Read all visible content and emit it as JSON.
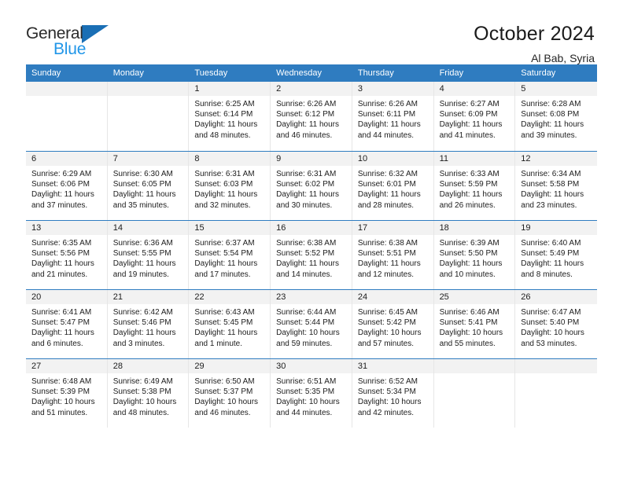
{
  "logo": {
    "line1": "General",
    "line2": "Blue",
    "triangle_icon": "logo-triangle-icon",
    "accent_dark": "#1a6fb5",
    "accent_light": "#2196e8"
  },
  "header": {
    "title": "October 2024",
    "subtitle": "Al Bab, Syria"
  },
  "theme": {
    "header_blue": "#2f7cc0",
    "daynum_band": "#f2f2f2",
    "cell_border": "#e6e6e6"
  },
  "weekdays": [
    "Sunday",
    "Monday",
    "Tuesday",
    "Wednesday",
    "Thursday",
    "Friday",
    "Saturday"
  ],
  "labels": {
    "sunrise": "Sunrise:",
    "sunset": "Sunset:",
    "daylight": "Daylight:"
  },
  "weeks": [
    [
      {
        "day": "",
        "sunrise": "",
        "sunset": "",
        "daylight": "",
        "empty": true
      },
      {
        "day": "",
        "sunrise": "",
        "sunset": "",
        "daylight": "",
        "empty": true
      },
      {
        "day": "1",
        "sunrise": "Sunrise: 6:25 AM",
        "sunset": "Sunset: 6:14 PM",
        "daylight": "Daylight: 11 hours and 48 minutes."
      },
      {
        "day": "2",
        "sunrise": "Sunrise: 6:26 AM",
        "sunset": "Sunset: 6:12 PM",
        "daylight": "Daylight: 11 hours and 46 minutes."
      },
      {
        "day": "3",
        "sunrise": "Sunrise: 6:26 AM",
        "sunset": "Sunset: 6:11 PM",
        "daylight": "Daylight: 11 hours and 44 minutes."
      },
      {
        "day": "4",
        "sunrise": "Sunrise: 6:27 AM",
        "sunset": "Sunset: 6:09 PM",
        "daylight": "Daylight: 11 hours and 41 minutes."
      },
      {
        "day": "5",
        "sunrise": "Sunrise: 6:28 AM",
        "sunset": "Sunset: 6:08 PM",
        "daylight": "Daylight: 11 hours and 39 minutes."
      }
    ],
    [
      {
        "day": "6",
        "sunrise": "Sunrise: 6:29 AM",
        "sunset": "Sunset: 6:06 PM",
        "daylight": "Daylight: 11 hours and 37 minutes."
      },
      {
        "day": "7",
        "sunrise": "Sunrise: 6:30 AM",
        "sunset": "Sunset: 6:05 PM",
        "daylight": "Daylight: 11 hours and 35 minutes."
      },
      {
        "day": "8",
        "sunrise": "Sunrise: 6:31 AM",
        "sunset": "Sunset: 6:03 PM",
        "daylight": "Daylight: 11 hours and 32 minutes."
      },
      {
        "day": "9",
        "sunrise": "Sunrise: 6:31 AM",
        "sunset": "Sunset: 6:02 PM",
        "daylight": "Daylight: 11 hours and 30 minutes."
      },
      {
        "day": "10",
        "sunrise": "Sunrise: 6:32 AM",
        "sunset": "Sunset: 6:01 PM",
        "daylight": "Daylight: 11 hours and 28 minutes."
      },
      {
        "day": "11",
        "sunrise": "Sunrise: 6:33 AM",
        "sunset": "Sunset: 5:59 PM",
        "daylight": "Daylight: 11 hours and 26 minutes."
      },
      {
        "day": "12",
        "sunrise": "Sunrise: 6:34 AM",
        "sunset": "Sunset: 5:58 PM",
        "daylight": "Daylight: 11 hours and 23 minutes."
      }
    ],
    [
      {
        "day": "13",
        "sunrise": "Sunrise: 6:35 AM",
        "sunset": "Sunset: 5:56 PM",
        "daylight": "Daylight: 11 hours and 21 minutes."
      },
      {
        "day": "14",
        "sunrise": "Sunrise: 6:36 AM",
        "sunset": "Sunset: 5:55 PM",
        "daylight": "Daylight: 11 hours and 19 minutes."
      },
      {
        "day": "15",
        "sunrise": "Sunrise: 6:37 AM",
        "sunset": "Sunset: 5:54 PM",
        "daylight": "Daylight: 11 hours and 17 minutes."
      },
      {
        "day": "16",
        "sunrise": "Sunrise: 6:38 AM",
        "sunset": "Sunset: 5:52 PM",
        "daylight": "Daylight: 11 hours and 14 minutes."
      },
      {
        "day": "17",
        "sunrise": "Sunrise: 6:38 AM",
        "sunset": "Sunset: 5:51 PM",
        "daylight": "Daylight: 11 hours and 12 minutes."
      },
      {
        "day": "18",
        "sunrise": "Sunrise: 6:39 AM",
        "sunset": "Sunset: 5:50 PM",
        "daylight": "Daylight: 11 hours and 10 minutes."
      },
      {
        "day": "19",
        "sunrise": "Sunrise: 6:40 AM",
        "sunset": "Sunset: 5:49 PM",
        "daylight": "Daylight: 11 hours and 8 minutes."
      }
    ],
    [
      {
        "day": "20",
        "sunrise": "Sunrise: 6:41 AM",
        "sunset": "Sunset: 5:47 PM",
        "daylight": "Daylight: 11 hours and 6 minutes."
      },
      {
        "day": "21",
        "sunrise": "Sunrise: 6:42 AM",
        "sunset": "Sunset: 5:46 PM",
        "daylight": "Daylight: 11 hours and 3 minutes."
      },
      {
        "day": "22",
        "sunrise": "Sunrise: 6:43 AM",
        "sunset": "Sunset: 5:45 PM",
        "daylight": "Daylight: 11 hours and 1 minute."
      },
      {
        "day": "23",
        "sunrise": "Sunrise: 6:44 AM",
        "sunset": "Sunset: 5:44 PM",
        "daylight": "Daylight: 10 hours and 59 minutes."
      },
      {
        "day": "24",
        "sunrise": "Sunrise: 6:45 AM",
        "sunset": "Sunset: 5:42 PM",
        "daylight": "Daylight: 10 hours and 57 minutes."
      },
      {
        "day": "25",
        "sunrise": "Sunrise: 6:46 AM",
        "sunset": "Sunset: 5:41 PM",
        "daylight": "Daylight: 10 hours and 55 minutes."
      },
      {
        "day": "26",
        "sunrise": "Sunrise: 6:47 AM",
        "sunset": "Sunset: 5:40 PM",
        "daylight": "Daylight: 10 hours and 53 minutes."
      }
    ],
    [
      {
        "day": "27",
        "sunrise": "Sunrise: 6:48 AM",
        "sunset": "Sunset: 5:39 PM",
        "daylight": "Daylight: 10 hours and 51 minutes."
      },
      {
        "day": "28",
        "sunrise": "Sunrise: 6:49 AM",
        "sunset": "Sunset: 5:38 PM",
        "daylight": "Daylight: 10 hours and 48 minutes."
      },
      {
        "day": "29",
        "sunrise": "Sunrise: 6:50 AM",
        "sunset": "Sunset: 5:37 PM",
        "daylight": "Daylight: 10 hours and 46 minutes."
      },
      {
        "day": "30",
        "sunrise": "Sunrise: 6:51 AM",
        "sunset": "Sunset: 5:35 PM",
        "daylight": "Daylight: 10 hours and 44 minutes."
      },
      {
        "day": "31",
        "sunrise": "Sunrise: 6:52 AM",
        "sunset": "Sunset: 5:34 PM",
        "daylight": "Daylight: 10 hours and 42 minutes."
      },
      {
        "day": "",
        "sunrise": "",
        "sunset": "",
        "daylight": "",
        "empty": true
      },
      {
        "day": "",
        "sunrise": "",
        "sunset": "",
        "daylight": "",
        "empty": true
      }
    ]
  ]
}
